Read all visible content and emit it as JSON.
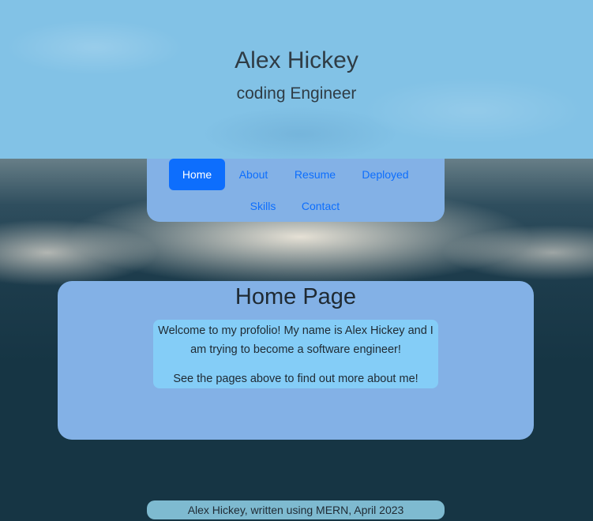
{
  "header": {
    "name": "Alex Hickey",
    "tagline": "coding Engineer"
  },
  "nav": {
    "items": [
      {
        "label": "Home",
        "active": true
      },
      {
        "label": "About",
        "active": false
      },
      {
        "label": "Resume",
        "active": false
      },
      {
        "label": "Deployed",
        "active": false
      },
      {
        "label": "Skills",
        "active": false
      },
      {
        "label": "Contact",
        "active": false
      }
    ]
  },
  "main": {
    "title": "Home Page",
    "paragraphs": [
      "Welcome to my profolio! My name is Alex Hickey and I am trying to become a software engineer!",
      "See the pages above to find out more about me!"
    ]
  },
  "footer": {
    "text": "Alex Hickey, written using MERN, April 2023"
  },
  "colors": {
    "hero_bg": "#82c2e6",
    "panel_bg": "#83b1e6",
    "inner_bg": "#84cdf7",
    "footer_bg": "#7ebad0",
    "link": "#0d6efd",
    "active_bg": "#0d6efd"
  }
}
